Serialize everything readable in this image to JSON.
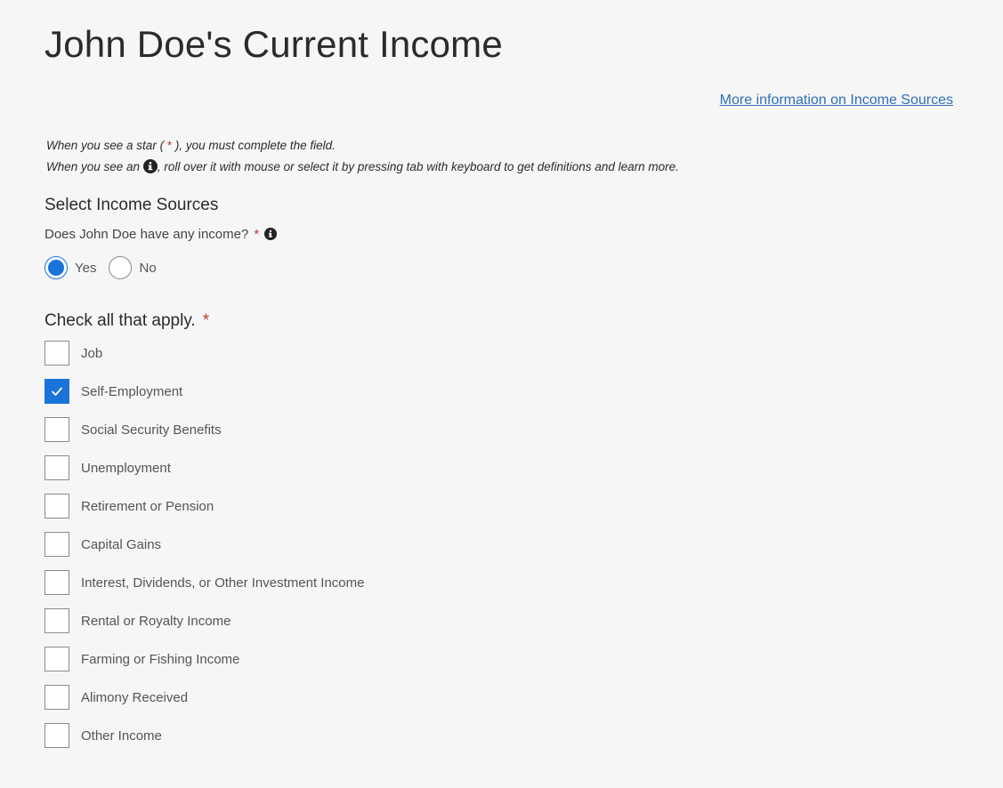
{
  "page": {
    "title": "John Doe's Current Income",
    "more_info_link": "More information on Income Sources"
  },
  "instructions": {
    "line1_before": "When you see a star ( ",
    "line1_star": "*",
    "line1_after": " ), you must complete the field.",
    "line2_before": "When you see an ",
    "line2_after": ", roll over it with mouse or select it by pressing tab with keyboard to get definitions and learn more."
  },
  "income_section": {
    "heading": "Select Income Sources",
    "question": "Does John Doe have any income?",
    "required_marker": "*",
    "options": [
      {
        "label": "Yes",
        "selected": true
      },
      {
        "label": "No",
        "selected": false
      }
    ]
  },
  "checklist": {
    "heading": "Check all that apply.",
    "required_marker": "*",
    "items": [
      {
        "label": "Job",
        "checked": false
      },
      {
        "label": "Self-Employment",
        "checked": true
      },
      {
        "label": "Social Security Benefits",
        "checked": false
      },
      {
        "label": "Unemployment",
        "checked": false
      },
      {
        "label": "Retirement or Pension",
        "checked": false
      },
      {
        "label": "Capital Gains",
        "checked": false
      },
      {
        "label": "Interest, Dividends, or Other Investment Income",
        "checked": false
      },
      {
        "label": "Rental or Royalty Income",
        "checked": false
      },
      {
        "label": "Farming or Fishing Income",
        "checked": false
      },
      {
        "label": "Alimony Received",
        "checked": false
      },
      {
        "label": "Other Income",
        "checked": false
      }
    ]
  },
  "colors": {
    "accent": "#1a73d9",
    "link": "#2e6fb7",
    "required": "#c0392b",
    "background": "#f6f6f6"
  },
  "icons": {
    "info": "info-circle-icon",
    "check": "checkmark-icon"
  }
}
